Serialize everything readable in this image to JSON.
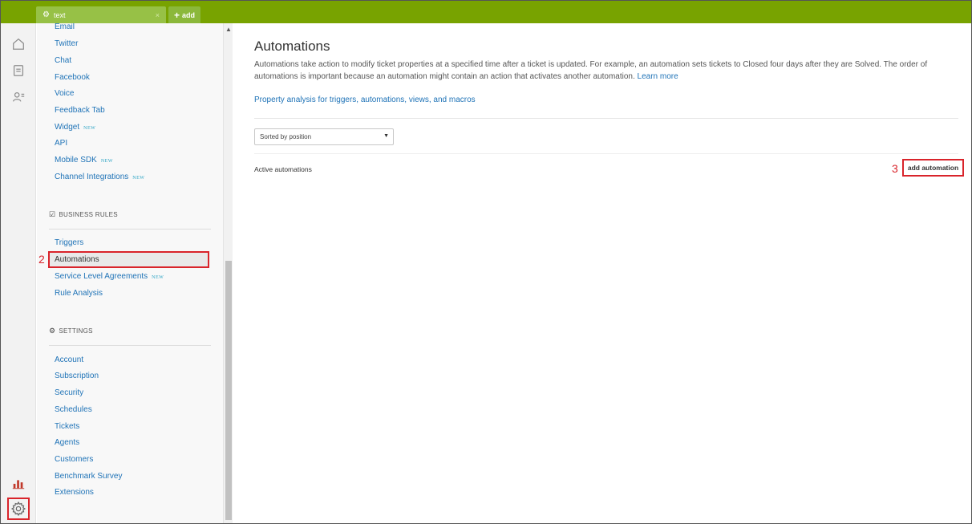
{
  "topbar": {
    "tab_label": "text",
    "tab_close": "×",
    "add_label": "add",
    "color": "#78a300"
  },
  "rail": {
    "icons": [
      "home-icon",
      "tickets-icon",
      "users-icon",
      "reporting-icon",
      "admin-gear-icon"
    ]
  },
  "sidebar": {
    "channels": [
      {
        "label": "Email",
        "new": ""
      },
      {
        "label": "Twitter",
        "new": ""
      },
      {
        "label": "Chat",
        "new": ""
      },
      {
        "label": "Facebook",
        "new": ""
      },
      {
        "label": "Voice",
        "new": ""
      },
      {
        "label": "Feedback Tab",
        "new": ""
      },
      {
        "label": "Widget",
        "new": "NEW"
      },
      {
        "label": "API",
        "new": ""
      },
      {
        "label": "Mobile SDK",
        "new": "NEW"
      },
      {
        "label": "Channel Integrations",
        "new": "NEW"
      }
    ],
    "business_rules_header": "BUSINESS RULES",
    "business_rules": [
      {
        "label": "Triggers",
        "new": ""
      },
      {
        "label": "Automations",
        "new": ""
      },
      {
        "label": "Service Level Agreements",
        "new": "NEW"
      },
      {
        "label": "Rule Analysis",
        "new": ""
      }
    ],
    "settings_header": "SETTINGS",
    "settings": [
      {
        "label": "Account"
      },
      {
        "label": "Subscription"
      },
      {
        "label": "Security"
      },
      {
        "label": "Schedules"
      },
      {
        "label": "Tickets"
      },
      {
        "label": "Agents"
      },
      {
        "label": "Customers"
      },
      {
        "label": "Benchmark Survey"
      },
      {
        "label": "Extensions"
      }
    ]
  },
  "annotations": {
    "step2": "2",
    "step3": "3",
    "highlight_color": "#d9242b"
  },
  "main": {
    "title": "Automations",
    "description": "Automations take action to modify ticket properties at a specified time after a ticket is updated. For example, an automation sets tickets to Closed four days after they are Solved. The order of automations is important because an automation might contain an action that activates another automation.",
    "learn_more": "Learn more",
    "property_link": "Property analysis for triggers, automations, views, and macros",
    "sort_value": "Sorted by position",
    "active_label": "Active automations",
    "add_button": "add automation"
  }
}
